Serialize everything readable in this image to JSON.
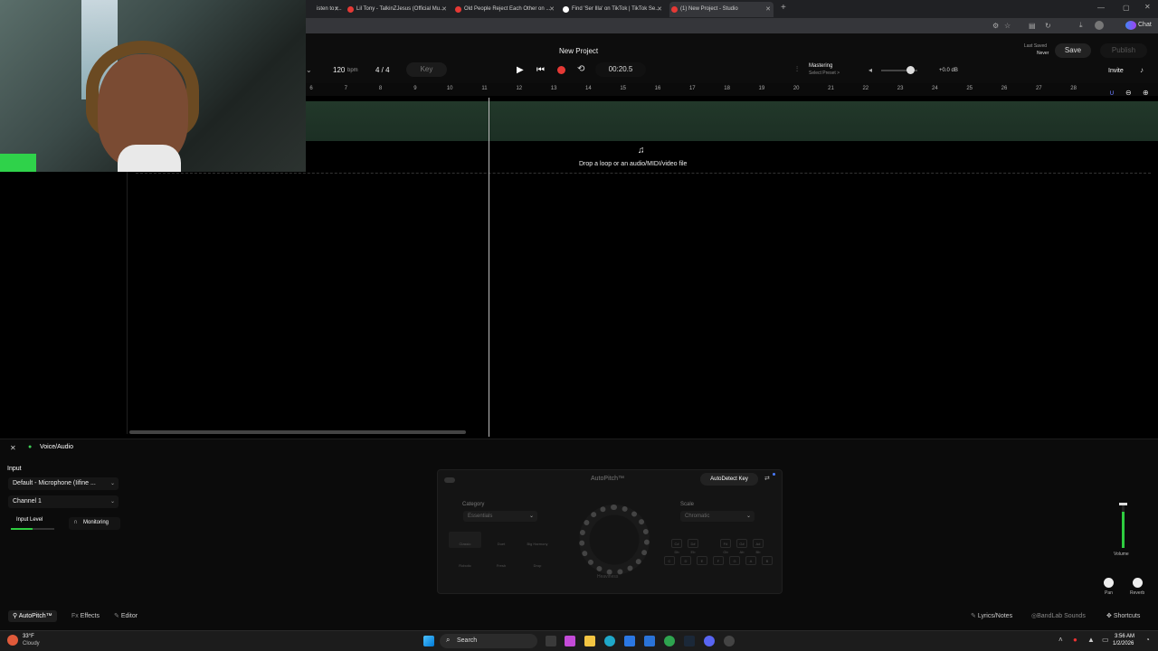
{
  "browser": {
    "tabs": [
      {
        "label": "isten to r...",
        "color": "#e53935"
      },
      {
        "label": "Lil Tony - TalkinZJesus (Official Mu...",
        "color": "#e53935"
      },
      {
        "label": "Old People Reject Each Other on ...",
        "color": "#e53935"
      },
      {
        "label": "Find 'Ser Illa' on TikTok | TikTok Se...",
        "color": "#ffffff"
      },
      {
        "label": "(1) New Project - Studio",
        "color": "#e53935"
      }
    ],
    "new_tab": "+",
    "profile_label": "Chat"
  },
  "studio": {
    "title": "New Project",
    "bpm_value": "120",
    "bpm_unit": "bpm",
    "time_signature": "4 / 4",
    "key_label": "Key",
    "time_display": "00:20.5",
    "mastering_label": "Mastering",
    "mastering_sub": "Select Preset >",
    "volume_db": "+0.0 dB",
    "last_saved_label": "Last Saved",
    "last_saved_value": "Never",
    "save_label": "Save",
    "publish_label": "Publish",
    "invite_label": "Invite",
    "drop_text": "Drop a loop or an audio/MIDI/video file",
    "ruler": [
      "6",
      "7",
      "8",
      "9",
      "10",
      "11",
      "12",
      "13",
      "14",
      "15",
      "16",
      "17",
      "18",
      "19",
      "20",
      "21",
      "22",
      "23",
      "24",
      "25",
      "26",
      "27",
      "28"
    ]
  },
  "panel": {
    "track_name": "Voice/Audio",
    "input_heading": "Input",
    "input_device": "Default - Microphone (Iifine ...",
    "channel": "Channel 1",
    "input_level_label": "Input Level",
    "monitoring_label": "Monitoring",
    "autopitch_title": "AutoPitch™",
    "autodetect_label": "AutoDetect Key",
    "category_label": "Category",
    "category_value": "Essentials",
    "scale_label": "Scale",
    "scale_value": "Chromatic",
    "category_items": [
      "Classic",
      "Duet",
      "Big Harmony",
      "Robotic",
      "Fresh",
      "Drop"
    ],
    "knob_label": "Heaviness",
    "top_keys": [
      "C# Db",
      "D# Eb",
      "F# Gb",
      "G# Ab",
      "A# Bb"
    ],
    "bottom_keys": [
      "C",
      "D",
      "E",
      "F",
      "G",
      "A",
      "B"
    ],
    "volume_label": "Volume",
    "pan_label": "Pan",
    "reverb_label": "Reverb"
  },
  "bottom_tabs": {
    "autopitch": "AutoPitch™",
    "effects": "Effects",
    "editor": "Editor",
    "lyrics": "Lyrics/Notes",
    "sounds": "BandLab Sounds",
    "shortcuts": "Shortcuts"
  },
  "taskbar": {
    "weather_temp": "33°F",
    "weather_desc": "Cloudy",
    "search_label": "Search",
    "time": "3:56 AM",
    "date": "1/2/2026"
  }
}
